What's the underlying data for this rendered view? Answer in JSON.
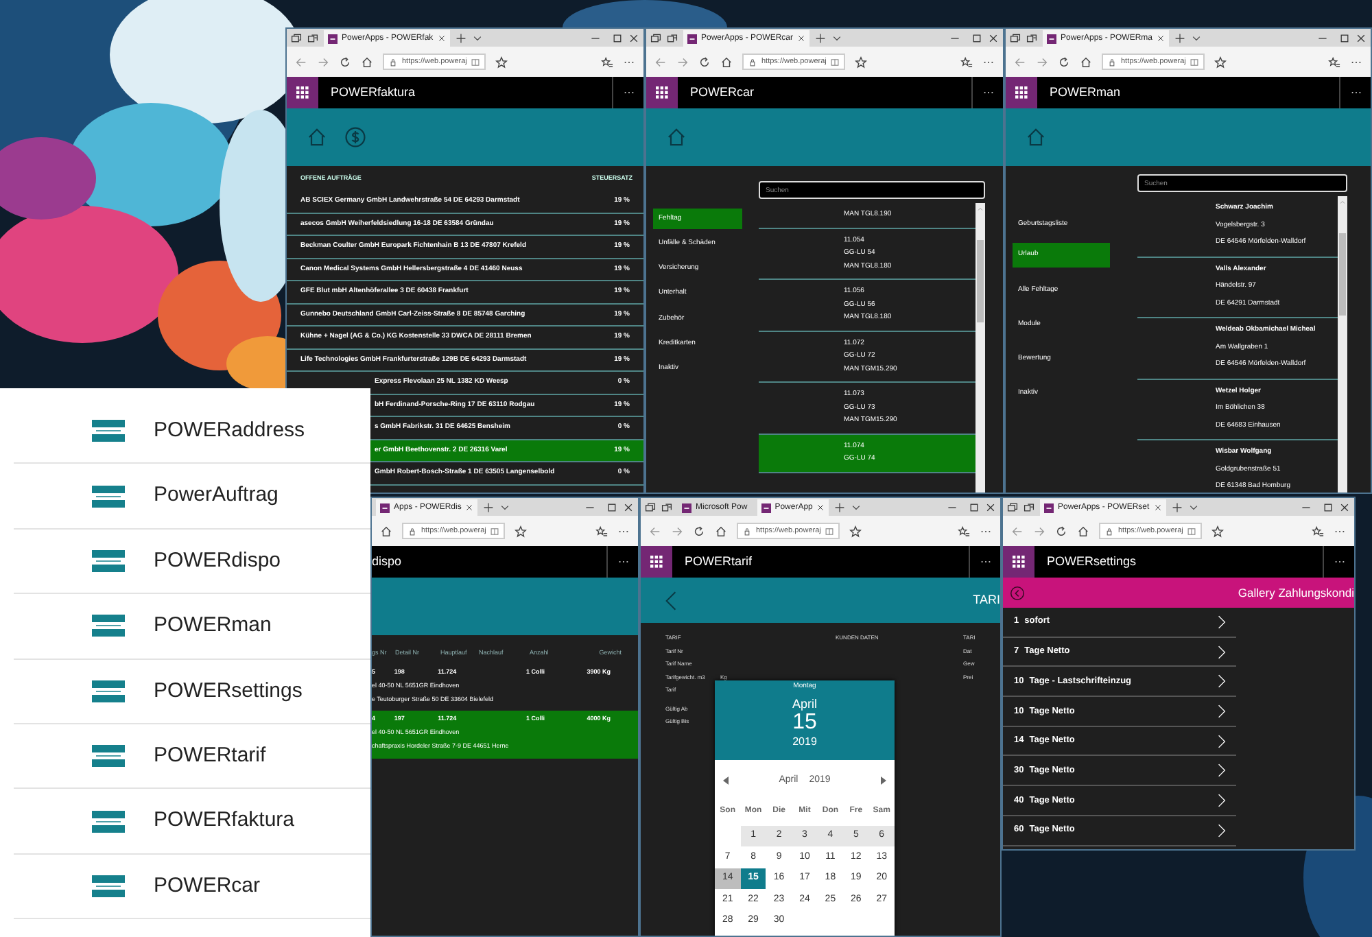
{
  "app_list": [
    {
      "label": "POWERaddress"
    },
    {
      "label": "PowerAuftrag"
    },
    {
      "label": "POWERdispo"
    },
    {
      "label": "POWERman"
    },
    {
      "label": "POWERsettings"
    },
    {
      "label": "POWERtarif"
    },
    {
      "label": "POWERfaktura"
    },
    {
      "label": "POWERcar"
    }
  ],
  "windows": [
    {
      "kind": "faktura",
      "tabs": [
        {
          "label": "PowerApps - POWERfak",
          "selected": true
        }
      ],
      "url": "https://web.poweraj",
      "app_title": "POWERfaktura",
      "columns": [
        "OFFENE AUFTRÄGE",
        "STEUERSATZ"
      ],
      "rows": [
        {
          "customer": "AB SCIEX Germany GmbH Landwehrstraße 54 DE 64293 Darmstadt",
          "tax": "19 %",
          "selected": false
        },
        {
          "customer": "asecos GmbH Weiherfeldsiedlung 16-18 DE 63584 Gründau",
          "tax": "19 %",
          "selected": false
        },
        {
          "customer": "Beckman Coulter GmbH Europark Fichtenhain B 13 DE 47807 Krefeld",
          "tax": "19 %",
          "selected": false
        },
        {
          "customer": "Canon Medical Systems GmbH Hellersbergstraße 4 DE 41460 Neuss",
          "tax": "19 %",
          "selected": false
        },
        {
          "customer": "GFE Blut mbH Altenhöferallee 3 DE 60438 Frankfurt",
          "tax": "19 %",
          "selected": false
        },
        {
          "customer": "Gunnebo Deutschland GmbH Carl-Zeiss-Straße 8 DE 85748 Garching",
          "tax": "19 %",
          "selected": false
        },
        {
          "customer": "Kühne + Nagel (AG & Co.) KG Kostenstelle 33 DWCA DE 28111 Bremen",
          "tax": "19 %",
          "selected": false
        },
        {
          "customer": "Life Technologies GmbH Frankfurterstraße 129B DE 64293 Darmstadt",
          "tax": "19 %",
          "selected": false
        },
        {
          "customer": "Express Flevolaan 25 NL 1382 KD Weesp",
          "tax": "0 %",
          "selected": false
        },
        {
          "customer": "bH Ferdinand-Porsche-Ring 17 DE 63110 Rodgau",
          "tax": "19 %",
          "selected": false
        },
        {
          "customer": "s GmbH Fabrikstr. 31 DE 64625 Bensheim",
          "tax": "0 %",
          "selected": false
        },
        {
          "customer": "er GmbH Beethovenstr. 2 DE 26316 Varel",
          "tax": "19 %",
          "selected": true
        },
        {
          "customer": "GmbH Robert-Bosch-Straße 1 DE 63505 Langenselbold",
          "tax": "0 %",
          "selected": false
        }
      ]
    },
    {
      "kind": "car",
      "tabs": [
        {
          "label": "PowerApps - POWERcar",
          "selected": true
        }
      ],
      "url": "https://web.poweraj",
      "app_title": "POWERcar",
      "nav": [
        {
          "label": "Fehltag",
          "selected": true
        },
        {
          "label": "Unfälle & Schäden",
          "selected": false
        },
        {
          "label": "Versicherung",
          "selected": false
        },
        {
          "label": "Unterhalt",
          "selected": false
        },
        {
          "label": "Zubehör",
          "selected": false
        },
        {
          "label": "Kreditkarten",
          "selected": false
        },
        {
          "label": "Inaktiv",
          "selected": false
        }
      ],
      "search": {
        "placeholder": "Suchen"
      },
      "items": [
        {
          "model": "MAN TGL8.190",
          "selected": false
        },
        {
          "number": "11.054",
          "plate": "GG-LU 54",
          "model": "MAN TGL8.180",
          "selected": false
        },
        {
          "number": "11.056",
          "plate": "GG-LU 56",
          "model": "MAN TGL8.180",
          "selected": false
        },
        {
          "number": "11.072",
          "plate": "GG-LU 72",
          "model": "MAN TGM15.290",
          "selected": false
        },
        {
          "number": "11.073",
          "plate": "GG-LU 73",
          "model": "MAN TGM15.290",
          "selected": false
        },
        {
          "number": "11.074",
          "plate": "GG-LU 74",
          "selected": true
        }
      ]
    },
    {
      "kind": "man",
      "tabs": [
        {
          "label": "PowerApps - POWERma",
          "selected": true
        }
      ],
      "url": "https://web.poweraj",
      "app_title": "POWERman",
      "nav": [
        {
          "label": "Geburtstagsliste",
          "selected": false
        },
        {
          "label": "Urlaub",
          "selected": true
        },
        {
          "label": "Alle Fehltage",
          "selected": false
        },
        {
          "label": "Module",
          "selected": false
        },
        {
          "label": "Bewertung",
          "selected": false
        },
        {
          "label": "Inaktiv",
          "selected": false
        }
      ],
      "search": {
        "placeholder": "Suchen"
      },
      "items": [
        {
          "name": "Schwarz Joachim",
          "street": "Vogelsbergstr. 3",
          "city": "DE 64546 Mörfelden-Walldorf",
          "selected": false
        },
        {
          "name": "Valls Alexander",
          "street": "Händelstr. 97",
          "city": "DE 64291 Darmstadt",
          "selected": false
        },
        {
          "name": "Weldeab Okbamichael Micheal",
          "street": "Am Wallgraben 1",
          "city": "DE 64546 Mörfelden-Walldorf",
          "selected": false
        },
        {
          "name": "Wetzel Holger",
          "street": "Im Böhlichen 38",
          "city": "DE 64683 Einhausen",
          "selected": false
        },
        {
          "name": "Wisbar Wolfgang",
          "street": "Goldgrubenstraße 51",
          "city": "DE 61348 Bad Homburg",
          "selected": false
        }
      ]
    },
    {
      "kind": "dispo",
      "tabs": [
        {
          "label": "Apps - POWERdis",
          "selected": true
        }
      ],
      "url": "https://web.poweraj",
      "app_title": "dispo",
      "columns": [
        "gs Nr",
        "Detail Nr",
        "Hauptlauf",
        "Nachlauf",
        "Anzahl",
        "Gewicht"
      ],
      "rows": [
        {
          "nr": "5",
          "detail": "198",
          "hauptlauf": "11.724",
          "anzahl": "1 Colli",
          "gewicht": "3900 Kg",
          "line_1": "el 40-50 NL 5651GR Eindhoven",
          "line_2": "e Teutoburger Straße 50 DE 33604 Bielefeld",
          "selected": false
        },
        {
          "nr": "4",
          "detail": "197",
          "hauptlauf": "11.724",
          "anzahl": "1 Colli",
          "gewicht": "4000 Kg",
          "line_1": "el 40-50 NL 5651GR Eindhoven",
          "line_2": "chaftspraxis Hordeler Straße 7-9 DE 44651 Herne",
          "selected": true
        }
      ]
    },
    {
      "kind": "tarif",
      "tabs": [
        {
          "label": "Microsoft Pow",
          "selected": false
        },
        {
          "label": "PowerApp",
          "selected": true
        }
      ],
      "url": "https://web.poweraj",
      "app_title": "POWERtarif",
      "header": "TARI",
      "left_labels": [
        "TARIF",
        "Tarif Nr",
        "Tarif Name",
        "Tarifgewicht. m3",
        "Tarif",
        "Gültig Ab",
        "Gültig Bis"
      ],
      "unit": "Kg",
      "middle_heading": "KUNDEN DATEN",
      "right_labels": [
        "TARI",
        "Dat",
        "Gew",
        "Prei"
      ],
      "calendar": {
        "weekday": "Montag",
        "month": "April",
        "day": "15",
        "year": "2019",
        "nav_month": "April",
        "nav_year": "2019",
        "weekdays": [
          "Son",
          "Mon",
          "Die",
          "Mit",
          "Don",
          "Fre",
          "Sam"
        ],
        "weeks": [
          [
            {
              "kind": "blank"
            },
            {
              "kind": "day",
              "label": "1",
              "selected": false,
              "highlighted": false,
              "shaded": true
            },
            {
              "kind": "day",
              "label": "2",
              "selected": false,
              "highlighted": false,
              "shaded": true
            },
            {
              "kind": "day",
              "label": "3",
              "selected": false,
              "highlighted": false,
              "shaded": true
            },
            {
              "kind": "day",
              "label": "4",
              "selected": false,
              "highlighted": false,
              "shaded": true
            },
            {
              "kind": "day",
              "label": "5",
              "selected": false,
              "highlighted": false,
              "shaded": true
            },
            {
              "kind": "day",
              "label": "6",
              "selected": false,
              "highlighted": false,
              "shaded": true
            }
          ],
          [
            {
              "kind": "day",
              "label": "7",
              "selected": false,
              "highlighted": false,
              "shaded": false
            },
            {
              "kind": "day",
              "label": "8",
              "selected": false,
              "highlighted": false,
              "shaded": false
            },
            {
              "kind": "day",
              "label": "9",
              "selected": false,
              "highlighted": false,
              "shaded": false
            },
            {
              "kind": "day",
              "label": "10",
              "selected": false,
              "highlighted": false,
              "shaded": false
            },
            {
              "kind": "day",
              "label": "11",
              "selected": false,
              "highlighted": false,
              "shaded": false
            },
            {
              "kind": "day",
              "label": "12",
              "selected": false,
              "highlighted": false,
              "shaded": false
            },
            {
              "kind": "day",
              "label": "13",
              "selected": false,
              "highlighted": false,
              "shaded": false
            }
          ],
          [
            {
              "kind": "day",
              "label": "14",
              "selected": false,
              "highlighted": true,
              "shaded": false
            },
            {
              "kind": "day",
              "label": "15",
              "selected": true,
              "highlighted": false,
              "shaded": false
            },
            {
              "kind": "day",
              "label": "16",
              "selected": false,
              "highlighted": false,
              "shaded": false
            },
            {
              "kind": "day",
              "label": "17",
              "selected": false,
              "highlighted": false,
              "shaded": false
            },
            {
              "kind": "day",
              "label": "18",
              "selected": false,
              "highlighted": false,
              "shaded": false
            },
            {
              "kind": "day",
              "label": "19",
              "selected": false,
              "highlighted": false,
              "shaded": false
            },
            {
              "kind": "day",
              "label": "20",
              "selected": false,
              "highlighted": false,
              "shaded": false
            }
          ],
          [
            {
              "kind": "day",
              "label": "21",
              "selected": false,
              "highlighted": false,
              "shaded": false
            },
            {
              "kind": "day",
              "label": "22",
              "selected": false,
              "highlighted": false,
              "shaded": false
            },
            {
              "kind": "day",
              "label": "23",
              "selected": false,
              "highlighted": false,
              "shaded": false
            },
            {
              "kind": "day",
              "label": "24",
              "selected": false,
              "highlighted": false,
              "shaded": false
            },
            {
              "kind": "day",
              "label": "25",
              "selected": false,
              "highlighted": false,
              "shaded": false
            },
            {
              "kind": "day",
              "label": "26",
              "selected": false,
              "highlighted": false,
              "shaded": false
            },
            {
              "kind": "day",
              "label": "27",
              "selected": false,
              "highlighted": false,
              "shaded": false
            }
          ],
          [
            {
              "kind": "day",
              "label": "28",
              "selected": false,
              "highlighted": false,
              "shaded": false
            },
            {
              "kind": "day",
              "label": "29",
              "selected": false,
              "highlighted": false,
              "shaded": false
            },
            {
              "kind": "day",
              "label": "30",
              "selected": false,
              "highlighted": false,
              "shaded": false
            }
          ]
        ]
      }
    },
    {
      "kind": "settings",
      "tabs": [
        {
          "label": "PowerApps - POWERset",
          "selected": true
        }
      ],
      "url": "https://web.poweraj",
      "app_title": "POWERsettings",
      "header": "Gallery Zahlungskondi",
      "items": [
        {
          "code": "1",
          "label": "sofort"
        },
        {
          "code": "7",
          "label": "Tage Netto"
        },
        {
          "code": "10",
          "label": "Tage - Lastschrifteinzug"
        },
        {
          "code": "10",
          "label": "Tage Netto"
        },
        {
          "code": "14",
          "label": "Tage Netto"
        },
        {
          "code": "30",
          "label": "Tage Netto"
        },
        {
          "code": "40",
          "label": "Tage Netto"
        },
        {
          "code": "60",
          "label": "Tage Netto"
        }
      ]
    }
  ]
}
